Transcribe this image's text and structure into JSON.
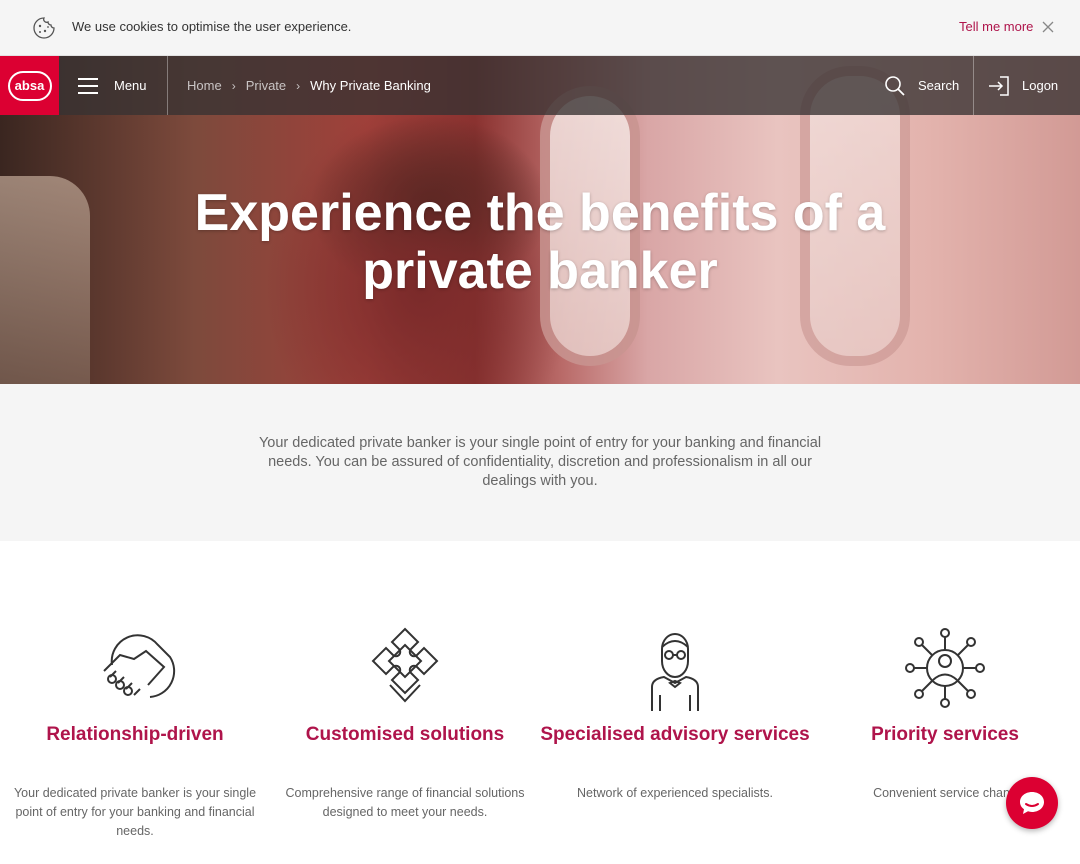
{
  "cookie_bar": {
    "message": "We use cookies to optimise the user experience.",
    "more_link": "Tell me more",
    "icons": {
      "cookie": "cookie-icon",
      "close": "close-icon"
    }
  },
  "nav": {
    "logo_text": "absa",
    "menu_label": "Menu",
    "breadcrumb": [
      "Home",
      "Private",
      "Why Private Banking"
    ],
    "search_label": "Search",
    "logon_label": "Logon",
    "icons": {
      "menu": "hamburger-icon",
      "search": "search-icon",
      "logon": "logon-icon",
      "separator": "chevron-right-icon"
    }
  },
  "hero": {
    "title": "Experience the benefits of a private banker"
  },
  "intro": {
    "text": "Your dedicated private banker is your single point of entry for your banking and financial needs. You can be assured of confidentiality, discretion and professionalism in all our dealings with you."
  },
  "features": [
    {
      "title": "Relationship-driven",
      "description": "Your dedicated private banker is your single point of entry for your banking and financial needs.",
      "icon": "handshake-icon"
    },
    {
      "title": "Customised solutions",
      "description": "Comprehensive range of financial solutions designed to meet your needs.",
      "icon": "puzzle-icon"
    },
    {
      "title": "Specialised advisory services",
      "description": "Network of experienced specialists.",
      "icon": "advisor-icon"
    },
    {
      "title": "Priority services",
      "description": "Convenient service chann",
      "icon": "network-icon"
    }
  ],
  "chat": {
    "icon": "chat-icon"
  },
  "colors": {
    "brand_red": "#dc0032",
    "accent_text": "#af144b",
    "nav_overlay": "#373232",
    "band_grey": "#f5f5f5"
  }
}
